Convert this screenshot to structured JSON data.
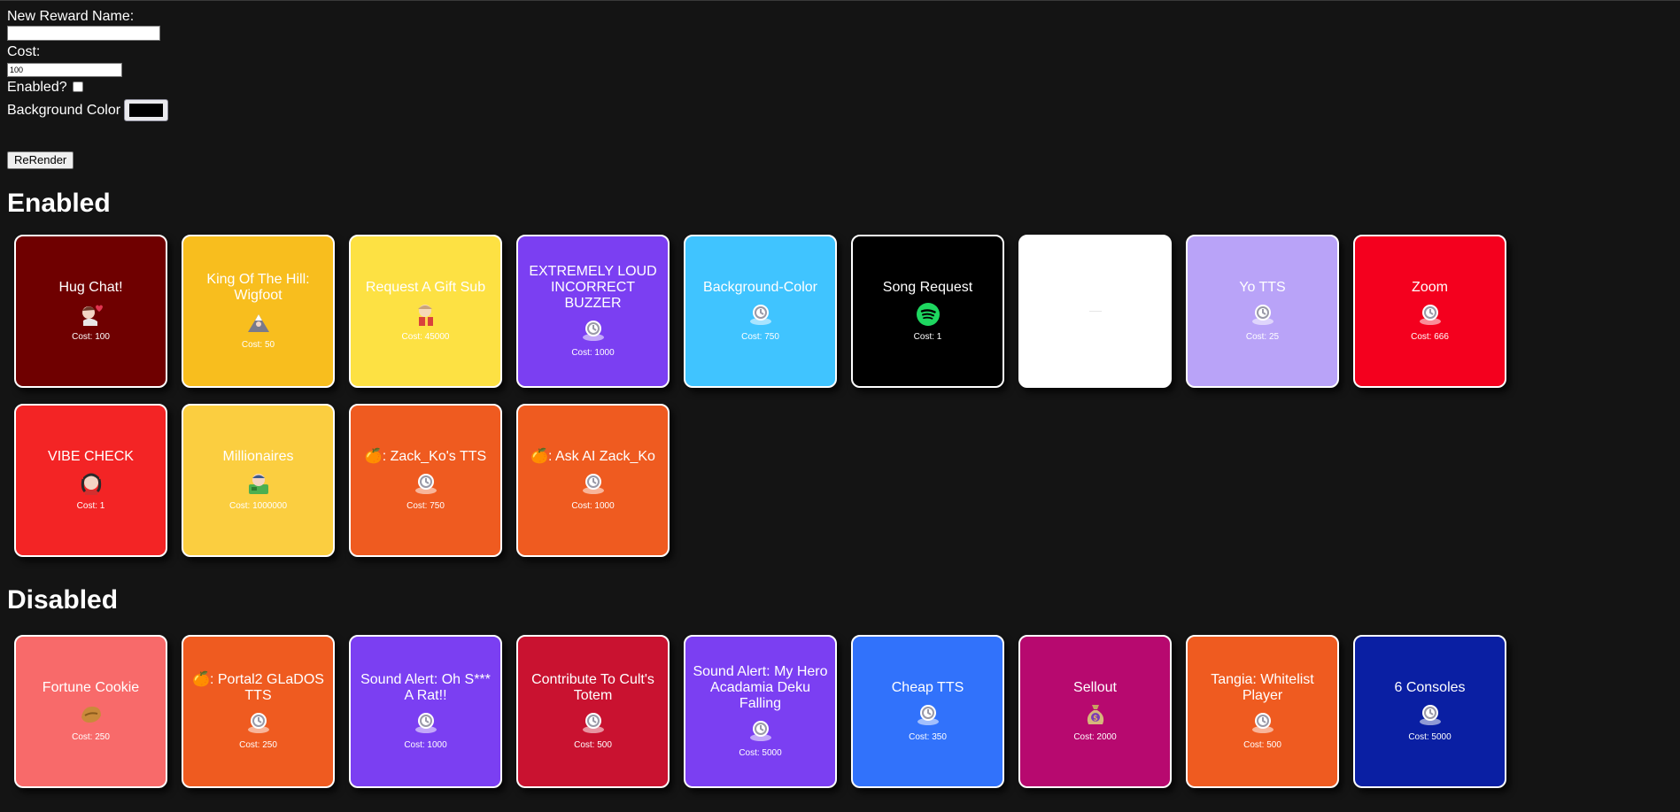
{
  "form": {
    "name_label": "New Reward Name:",
    "name_value": "",
    "cost_label": "Cost:",
    "cost_value": "100",
    "enabled_label": "Enabled?",
    "enabled_checked": false,
    "bg_label": "Background Color",
    "bg_value": "#000000",
    "rerender_label": "ReRender"
  },
  "sections": {
    "enabled_heading": "Enabled",
    "disabled_heading": "Disabled"
  },
  "enabled": [
    {
      "title": "Hug Chat!",
      "cost": "Cost: 100",
      "bg": "#6f0000",
      "icon": "hug-emote-icon"
    },
    {
      "title": "King Of The Hill: Wigfoot",
      "cost": "Cost: 50",
      "bg": "#f8be1e",
      "icon": "mountain-emote-icon"
    },
    {
      "title": "Request A Gift Sub",
      "cost": "Cost: 45000",
      "bg": "#fde143",
      "icon": "gift-emote-icon"
    },
    {
      "title": "EXTREMELY LOUD INCORRECT BUZZER",
      "cost": "Cost: 1000",
      "bg": "#7b3ff2",
      "icon": "default-reward-icon"
    },
    {
      "title": "Background-Color",
      "cost": "Cost: 750",
      "bg": "#40c4ff",
      "icon": "default-reward-icon"
    },
    {
      "title": "Song Request",
      "cost": "Cost: 1",
      "bg": "#000000",
      "icon": "spotify-icon"
    },
    {
      "title": "",
      "cost": "",
      "bg": "#ffffff",
      "icon": "none"
    },
    {
      "title": "Yo TTS",
      "cost": "Cost: 25",
      "bg": "#b9a3f8",
      "icon": "default-reward-icon"
    },
    {
      "title": "Zoom",
      "cost": "Cost: 666",
      "bg": "#f4001e",
      "icon": "default-reward-icon"
    },
    {
      "title": "VIBE CHECK",
      "cost": "Cost: 1",
      "bg": "#f32425",
      "icon": "vibe-emote-icon"
    },
    {
      "title": "Millionaires",
      "cost": "Cost: 1000000",
      "bg": "#fbce40",
      "icon": "money-emote-icon"
    },
    {
      "title": "🍊: Zack_Ko's TTS",
      "cost": "Cost: 750",
      "bg": "#ef5b20",
      "icon": "default-reward-icon"
    },
    {
      "title": "🍊: Ask AI Zack_Ko",
      "cost": "Cost: 1000",
      "bg": "#ef5b20",
      "icon": "default-reward-icon"
    }
  ],
  "disabled": [
    {
      "title": "Fortune Cookie",
      "cost": "Cost: 250",
      "bg": "#f86a6a",
      "icon": "fortune-cookie-icon"
    },
    {
      "title": "🍊: Portal2 GLaDOS TTS",
      "cost": "Cost: 250",
      "bg": "#ef5b20",
      "icon": "default-reward-icon"
    },
    {
      "title": "Sound Alert: Oh S*** A Rat!!",
      "cost": "Cost: 1000",
      "bg": "#7b3ff2",
      "icon": "default-reward-icon"
    },
    {
      "title": "Contribute To Cult's Totem",
      "cost": "Cost: 500",
      "bg": "#c91230",
      "icon": "default-reward-icon"
    },
    {
      "title": "Sound Alert: My Hero Acadamia Deku Falling",
      "cost": "Cost: 5000",
      "bg": "#7b3ff2",
      "icon": "default-reward-icon"
    },
    {
      "title": "Cheap TTS",
      "cost": "Cost: 350",
      "bg": "#3172fb",
      "icon": "default-reward-icon"
    },
    {
      "title": "Sellout",
      "cost": "Cost: 2000",
      "bg": "#b7096f",
      "icon": "money-bag-icon"
    },
    {
      "title": "Tangia: Whitelist Player",
      "cost": "Cost: 500",
      "bg": "#ef5b20",
      "icon": "default-reward-icon"
    },
    {
      "title": "6 Consoles",
      "cost": "Cost: 5000",
      "bg": "#0a1fa3",
      "icon": "default-reward-icon"
    }
  ]
}
